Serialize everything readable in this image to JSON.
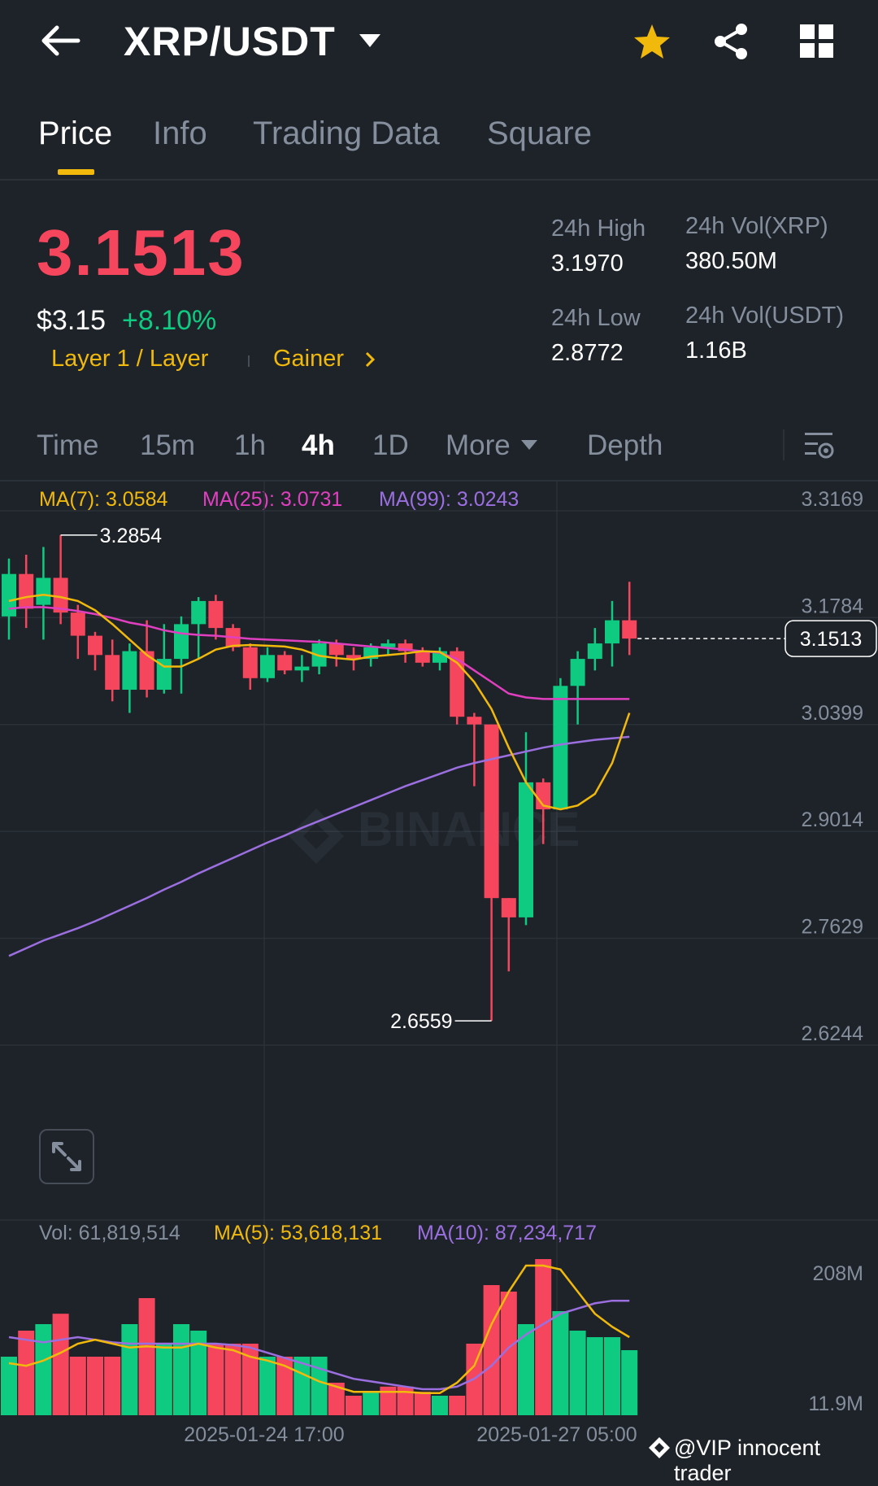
{
  "header": {
    "pair": "XRP/USDT",
    "icons": [
      "back-arrow-icon",
      "caret-down-icon",
      "star-icon",
      "share-icon",
      "grid-menu-icon"
    ],
    "accent": "#f0b90b"
  },
  "tabs": [
    {
      "label": "Price",
      "active": true
    },
    {
      "label": "Info",
      "active": false
    },
    {
      "label": "Trading Data",
      "active": false
    },
    {
      "label": "Square",
      "active": false
    }
  ],
  "ticker": {
    "last_price": "3.1513",
    "usd_price": "$3.15",
    "change_pct": "+8.10%",
    "category": "Layer 1 / Layer",
    "gainer_label": "Gainer",
    "high_label": "24h High",
    "high": "3.1970",
    "low_label": "24h Low",
    "low": "2.8772",
    "vol_base_label": "24h Vol(XRP)",
    "vol_base": "380.50M",
    "vol_quote_label": "24h Vol(USDT)",
    "vol_quote": "1.16B",
    "colors": {
      "down": "#f6465d",
      "up": "#0ecb81"
    }
  },
  "intervals": [
    {
      "label": "Time",
      "active": false
    },
    {
      "label": "15m",
      "active": false
    },
    {
      "label": "1h",
      "active": false
    },
    {
      "label": "4h",
      "active": true
    },
    {
      "label": "1D",
      "active": false
    },
    {
      "label": "More",
      "active": false
    },
    {
      "label": "Depth",
      "active": false
    }
  ],
  "ma_legend": {
    "ma7": "MA(7): 3.0584",
    "ma25": "MA(25): 3.0731",
    "ma99": "MA(99): 3.0243",
    "colors": {
      "ma7": "#f0b90b",
      "ma25": "#e040c0",
      "ma99": "#9b6fe0"
    }
  },
  "vol_legend": {
    "vol": "Vol: 61,819,514",
    "ma5": "MA(5): 53,618,131",
    "ma10": "MA(10): 87,234,717"
  },
  "chart_data": {
    "type": "candlestick",
    "interval": "4h",
    "price_axis_ticks": [
      "3.3169",
      "3.1784",
      "3.0399",
      "2.9014",
      "2.7629",
      "2.6244"
    ],
    "volume_axis_ticks": [
      "208M",
      "11.9M"
    ],
    "time_labels": [
      "2025-01-24 17:00",
      "2025-01-27 05:00"
    ],
    "max_marker": "3.2854",
    "min_marker": "2.6559",
    "current_price_tag": "3.1513",
    "ylim": [
      2.6244,
      3.3169
    ],
    "candles": [
      {
        "o": 3.18,
        "c": 3.235,
        "h": 3.255,
        "l": 3.15
      },
      {
        "o": 3.235,
        "c": 3.19,
        "h": 3.26,
        "l": 3.165
      },
      {
        "o": 3.195,
        "c": 3.23,
        "h": 3.27,
        "l": 3.15
      },
      {
        "o": 3.23,
        "c": 3.185,
        "h": 3.2854,
        "l": 3.17
      },
      {
        "o": 3.185,
        "c": 3.155,
        "h": 3.195,
        "l": 3.125
      },
      {
        "o": 3.155,
        "c": 3.13,
        "h": 3.16,
        "l": 3.11
      },
      {
        "o": 3.13,
        "c": 3.085,
        "h": 3.15,
        "l": 3.07
      },
      {
        "o": 3.085,
        "c": 3.135,
        "h": 3.145,
        "l": 3.055
      },
      {
        "o": 3.135,
        "c": 3.085,
        "h": 3.175,
        "l": 3.075
      },
      {
        "o": 3.085,
        "c": 3.125,
        "h": 3.17,
        "l": 3.08
      },
      {
        "o": 3.125,
        "c": 3.17,
        "h": 3.18,
        "l": 3.08
      },
      {
        "o": 3.17,
        "c": 3.2,
        "h": 3.205,
        "l": 3.125
      },
      {
        "o": 3.2,
        "c": 3.165,
        "h": 3.208,
        "l": 3.15
      },
      {
        "o": 3.165,
        "c": 3.14,
        "h": 3.17,
        "l": 3.135
      },
      {
        "o": 3.14,
        "c": 3.1,
        "h": 3.145,
        "l": 3.085
      },
      {
        "o": 3.1,
        "c": 3.13,
        "h": 3.14,
        "l": 3.095
      },
      {
        "o": 3.13,
        "c": 3.11,
        "h": 3.135,
        "l": 3.105
      },
      {
        "o": 3.11,
        "c": 3.115,
        "h": 3.13,
        "l": 3.095
      },
      {
        "o": 3.115,
        "c": 3.145,
        "h": 3.15,
        "l": 3.105
      },
      {
        "o": 3.145,
        "c": 3.13,
        "h": 3.15,
        "l": 3.115
      },
      {
        "o": 3.13,
        "c": 3.125,
        "h": 3.14,
        "l": 3.11
      },
      {
        "o": 3.125,
        "c": 3.14,
        "h": 3.145,
        "l": 3.115
      },
      {
        "o": 3.14,
        "c": 3.145,
        "h": 3.15,
        "l": 3.13
      },
      {
        "o": 3.145,
        "c": 3.135,
        "h": 3.15,
        "l": 3.12
      },
      {
        "o": 3.135,
        "c": 3.12,
        "h": 3.14,
        "l": 3.115
      },
      {
        "o": 3.12,
        "c": 3.135,
        "h": 3.14,
        "l": 3.11
      },
      {
        "o": 3.135,
        "c": 3.05,
        "h": 3.14,
        "l": 3.04
      },
      {
        "o": 3.05,
        "c": 3.04,
        "h": 3.055,
        "l": 2.96
      },
      {
        "o": 3.04,
        "c": 2.815,
        "h": 3.04,
        "l": 2.6559
      },
      {
        "o": 2.815,
        "c": 2.79,
        "h": 2.815,
        "l": 2.72
      },
      {
        "o": 2.79,
        "c": 2.965,
        "h": 3.03,
        "l": 2.78
      },
      {
        "o": 2.965,
        "c": 2.93,
        "h": 2.97,
        "l": 2.885
      },
      {
        "o": 2.93,
        "c": 3.09,
        "h": 3.1,
        "l": 2.93
      },
      {
        "o": 3.09,
        "c": 3.125,
        "h": 3.135,
        "l": 3.04
      },
      {
        "o": 3.125,
        "c": 3.145,
        "h": 3.165,
        "l": 3.11
      },
      {
        "o": 3.145,
        "c": 3.175,
        "h": 3.2,
        "l": 3.115
      },
      {
        "o": 3.175,
        "c": 3.1513,
        "h": 3.225,
        "l": 3.13
      }
    ],
    "ma7": [
      3.2,
      3.205,
      3.208,
      3.205,
      3.2,
      3.188,
      3.17,
      3.15,
      3.13,
      3.115,
      3.115,
      3.125,
      3.137,
      3.142,
      3.143,
      3.142,
      3.141,
      3.137,
      3.129,
      3.126,
      3.124,
      3.128,
      3.13,
      3.132,
      3.135,
      3.134,
      3.12,
      3.095,
      3.06,
      3.01,
      2.965,
      2.935,
      2.93,
      2.935,
      2.95,
      2.99,
      3.055
    ],
    "ma25": [
      3.19,
      3.192,
      3.192,
      3.19,
      3.187,
      3.183,
      3.178,
      3.172,
      3.168,
      3.162,
      3.158,
      3.156,
      3.155,
      3.153,
      3.151,
      3.15,
      3.149,
      3.148,
      3.147,
      3.145,
      3.143,
      3.141,
      3.139,
      3.137,
      3.135,
      3.133,
      3.125,
      3.11,
      3.095,
      3.08,
      3.075,
      3.073,
      3.073,
      3.073,
      3.073,
      3.073,
      3.073
    ],
    "ma99": [
      2.74,
      2.75,
      2.76,
      2.768,
      2.776,
      2.785,
      2.795,
      2.805,
      2.815,
      2.826,
      2.836,
      2.847,
      2.857,
      2.867,
      2.877,
      2.887,
      2.896,
      2.906,
      2.915,
      2.924,
      2.933,
      2.942,
      2.951,
      2.96,
      2.968,
      2.976,
      2.984,
      2.99,
      2.995,
      3.0,
      3.005,
      3.01,
      3.014,
      3.017,
      3.02,
      3.022,
      3.024
    ],
    "volumes": [
      45,
      65,
      70,
      78,
      45,
      45,
      45,
      70,
      90,
      55,
      70,
      65,
      55,
      55,
      55,
      45,
      45,
      45,
      45,
      25,
      15,
      18,
      22,
      22,
      18,
      15,
      15,
      55,
      100,
      95,
      70,
      120,
      80,
      65,
      60,
      60,
      50
    ],
    "volume_up": [
      true,
      false,
      true,
      false,
      false,
      false,
      false,
      true,
      false,
      true,
      true,
      true,
      false,
      false,
      false,
      true,
      false,
      true,
      true,
      false,
      false,
      true,
      false,
      false,
      false,
      true,
      false,
      false,
      false,
      false,
      true,
      false,
      true,
      true,
      true,
      true,
      true
    ],
    "vol_ma5": [
      40,
      38,
      42,
      48,
      55,
      58,
      55,
      52,
      53,
      52,
      52,
      55,
      52,
      50,
      45,
      42,
      38,
      32,
      26,
      22,
      18,
      18,
      18,
      18,
      17,
      17,
      25,
      38,
      70,
      95,
      115,
      115,
      112,
      95,
      78,
      68,
      60
    ],
    "vol_ma10": [
      60,
      58,
      56,
      58,
      60,
      58,
      56,
      55,
      55,
      55,
      55,
      55,
      55,
      54,
      52,
      48,
      44,
      40,
      36,
      32,
      28,
      26,
      24,
      22,
      20,
      20,
      22,
      28,
      38,
      52,
      62,
      70,
      78,
      82,
      86,
      88,
      88
    ]
  },
  "watermark": "BINANCE",
  "credit": "@VIP innocent trader"
}
